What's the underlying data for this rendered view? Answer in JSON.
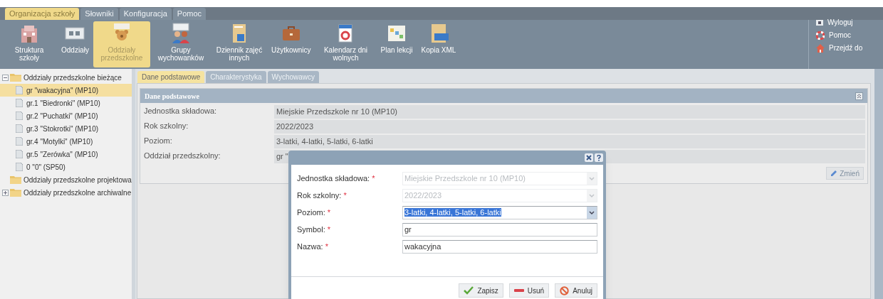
{
  "menu_tabs": [
    {
      "label": "Organizacja szkoły",
      "selected": true
    },
    {
      "label": "Słowniki",
      "selected": false
    },
    {
      "label": "Konfiguracja",
      "selected": false
    },
    {
      "label": "Pomoc",
      "selected": false
    }
  ],
  "toolbar": [
    {
      "label": "Struktura szkoły",
      "kind": "building",
      "selected": false
    },
    {
      "label": "Oddziały",
      "kind": "class",
      "selected": false
    },
    {
      "label": "Oddziały przedszkolne",
      "kind": "preschool",
      "selected": true
    },
    {
      "label": "Grupy wychowanków",
      "kind": "group",
      "selected": false
    },
    {
      "label": "Dziennik zajęć innych",
      "kind": "journal",
      "selected": false
    },
    {
      "label": "Użytkownicy",
      "kind": "case",
      "selected": false
    },
    {
      "label": "Kalendarz dni wolnych",
      "kind": "calendar",
      "selected": false
    },
    {
      "label": "Plan lekcji",
      "kind": "plan",
      "selected": false
    },
    {
      "label": "Kopia XML",
      "kind": "xml",
      "selected": false
    }
  ],
  "user_menu": [
    {
      "label": "Wyloguj",
      "kind": "logout"
    },
    {
      "label": "Pomoc",
      "kind": "help"
    },
    {
      "label": "Przejdź do",
      "kind": "home"
    }
  ],
  "tree": [
    {
      "label": "Oddziały przedszkolne bieżące",
      "expanded": true,
      "children": [
        {
          "label": "gr \"wakacyjna\" (MP10)",
          "selected": true
        },
        {
          "label": "gr.1 \"Biedronki\" (MP10)",
          "selected": false
        },
        {
          "label": "gr.2 \"Puchatki\" (MP10)",
          "selected": false
        },
        {
          "label": "gr.3 \"Stokrotki\" (MP10)",
          "selected": false
        },
        {
          "label": "gr.4 \"Motylki\" (MP10)",
          "selected": false
        },
        {
          "label": "gr.5 \"Zerówka\" (MP10)",
          "selected": false
        },
        {
          "label": "0 \"0\" (SP50)",
          "selected": false
        }
      ]
    },
    {
      "label": "Oddziały przedszkolne projektowa"
    },
    {
      "label": "Oddziały przedszkolne archiwalne",
      "expanded": false
    }
  ],
  "detail_tabs": [
    {
      "label": "Dane podstawowe",
      "selected": true
    },
    {
      "label": "Charakterystyka",
      "selected": false
    },
    {
      "label": "Wychowawcy",
      "selected": false
    }
  ],
  "panel": {
    "title": "Dane podstawowe",
    "rows": [
      {
        "label": "Jednostka składowa:",
        "value": "Miejskie Przedszkole nr 10 (MP10)"
      },
      {
        "label": "Rok szkolny:",
        "value": "2022/2023"
      },
      {
        "label": "Poziom:",
        "value": "3-latki, 4-latki, 5-latki, 6-latki"
      },
      {
        "label": "Oddział przedszkolny:",
        "value": "gr \""
      }
    ],
    "edit_button": "Zmień"
  },
  "dialog": {
    "fields": [
      {
        "label": "Jednostka składowa:",
        "required_mark": "*",
        "kind": "select",
        "value": "Miejskie Przedszkole nr 10 (MP10)",
        "disabled": true,
        "selected": false
      },
      {
        "label": "Rok szkolny:",
        "required_mark": "*",
        "kind": "select",
        "value": "2022/2023",
        "disabled": true,
        "selected": false
      },
      {
        "label": "Poziom:",
        "required_mark": "*",
        "kind": "select",
        "value": "3-latki, 4-latki, 5-latki, 6-latki",
        "disabled": false,
        "selected": true
      },
      {
        "label": "Symbol:",
        "required_mark": "*",
        "kind": "text",
        "value": "gr",
        "disabled": false,
        "selected": false
      },
      {
        "label": "Nazwa:",
        "required_mark": "*",
        "kind": "text",
        "value": "wakacyjna",
        "disabled": false,
        "selected": false
      }
    ],
    "buttons": [
      {
        "label": "Zapisz",
        "kind": "save"
      },
      {
        "label": "Usuń",
        "kind": "delete"
      },
      {
        "label": "Anuluj",
        "kind": "cancel"
      }
    ]
  }
}
